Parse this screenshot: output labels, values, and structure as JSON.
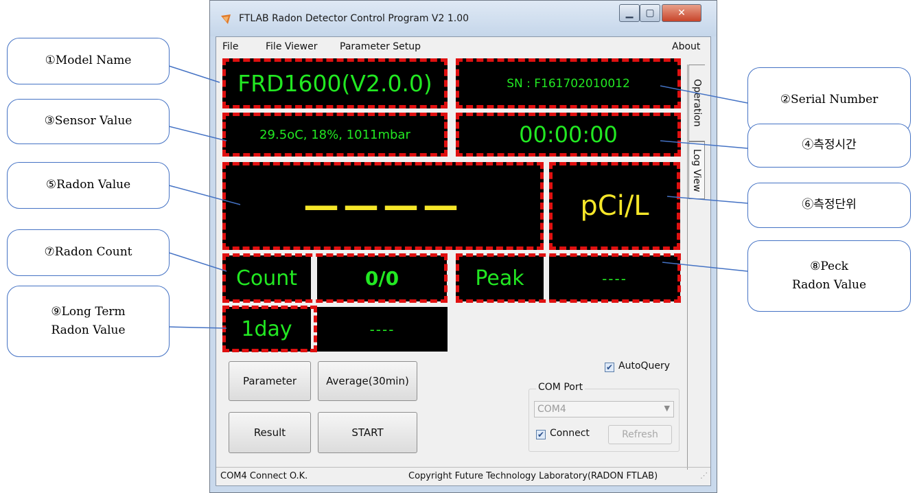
{
  "window": {
    "title": "FTLAB Radon Detector Control Program V2 1.00",
    "minimize_glyph": "▁",
    "maximize_glyph": "▢",
    "close_glyph": "✕"
  },
  "menu": {
    "file": "File",
    "file_viewer": "File Viewer",
    "parameter_setup": "Parameter Setup",
    "about": "About"
  },
  "tabs": {
    "operation": "Operation",
    "log_view": "Log View"
  },
  "display": {
    "model": "FRD1600(V2.0.0)",
    "serial": "SN : F161702010012",
    "sensor": "29.5oC, 18%, 1011mbar",
    "time": "00:00:00",
    "radon_value": "————",
    "unit": "pCi/L",
    "count_label": "Count",
    "count_value": "0/0",
    "peak_label": "Peak",
    "peak_value": "----",
    "day_label": "1day",
    "day_value": "----"
  },
  "buttons": {
    "parameter": "Parameter",
    "average": "Average(30min)",
    "result": "Result",
    "start": "START",
    "refresh": "Refresh"
  },
  "com": {
    "autoquery_label": "AutoQuery",
    "autoquery_checked": true,
    "group_label": "COM Port",
    "port_value": "COM4",
    "connect_label": "Connect",
    "connect_checked": true
  },
  "status": {
    "left": "COM4 Connect O.K.",
    "right": "Copyright Future Technology Laboratory(RADON FTLAB)"
  },
  "callouts": {
    "model_name": "①Model Name",
    "serial_number": "②Serial Number",
    "sensor_value": "③Sensor Value",
    "measure_time": "④측정시간",
    "radon_value": "⑤Radon Value",
    "measure_unit": "⑥측정단위",
    "radon_count": "⑦Radon Count",
    "peak_line1": "⑧Peck",
    "peak_line2": "Radon Value",
    "longterm_line1": "⑨Long Term",
    "longterm_line2": "Radon Value"
  },
  "colors": {
    "display_bg": "#000000",
    "green": "#22e822",
    "yellow": "#f5e629",
    "highlight": "#e01010",
    "callout_border": "#4472c4"
  }
}
